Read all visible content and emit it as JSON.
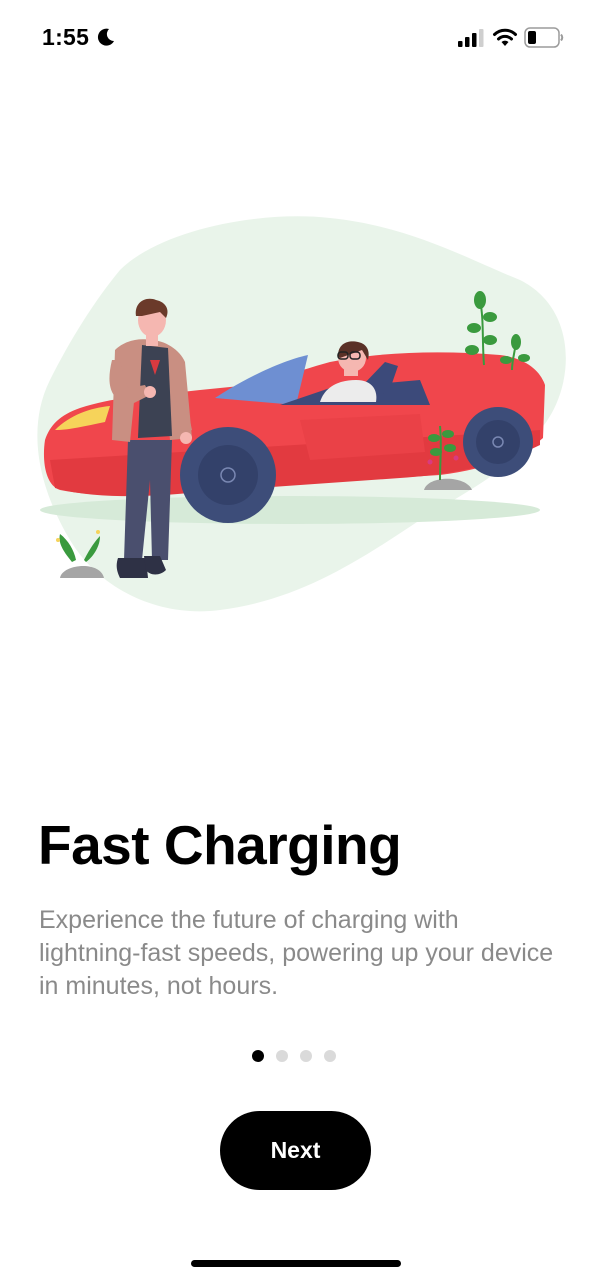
{
  "status_bar": {
    "time": "1:55",
    "icons": [
      "moon-icon",
      "cellular-signal-icon",
      "wifi-icon",
      "battery-icon"
    ]
  },
  "illustration": {
    "icon": "person-beside-red-convertible-car-illustration",
    "colors": {
      "blob": "#e9f4ea",
      "car": "#f0464c",
      "plants": "#3a9a3e"
    }
  },
  "onboarding": {
    "title": "Fast Charging",
    "description": "Experience the future of charging with lightning-fast speeds, powering up your device in minutes, not hours.",
    "page_index": 1,
    "page_count": 4,
    "next_label": "Next"
  },
  "colors": {
    "accent": "#000000",
    "description_text": "#8a8a8a",
    "dot_inactive": "#dadada"
  }
}
